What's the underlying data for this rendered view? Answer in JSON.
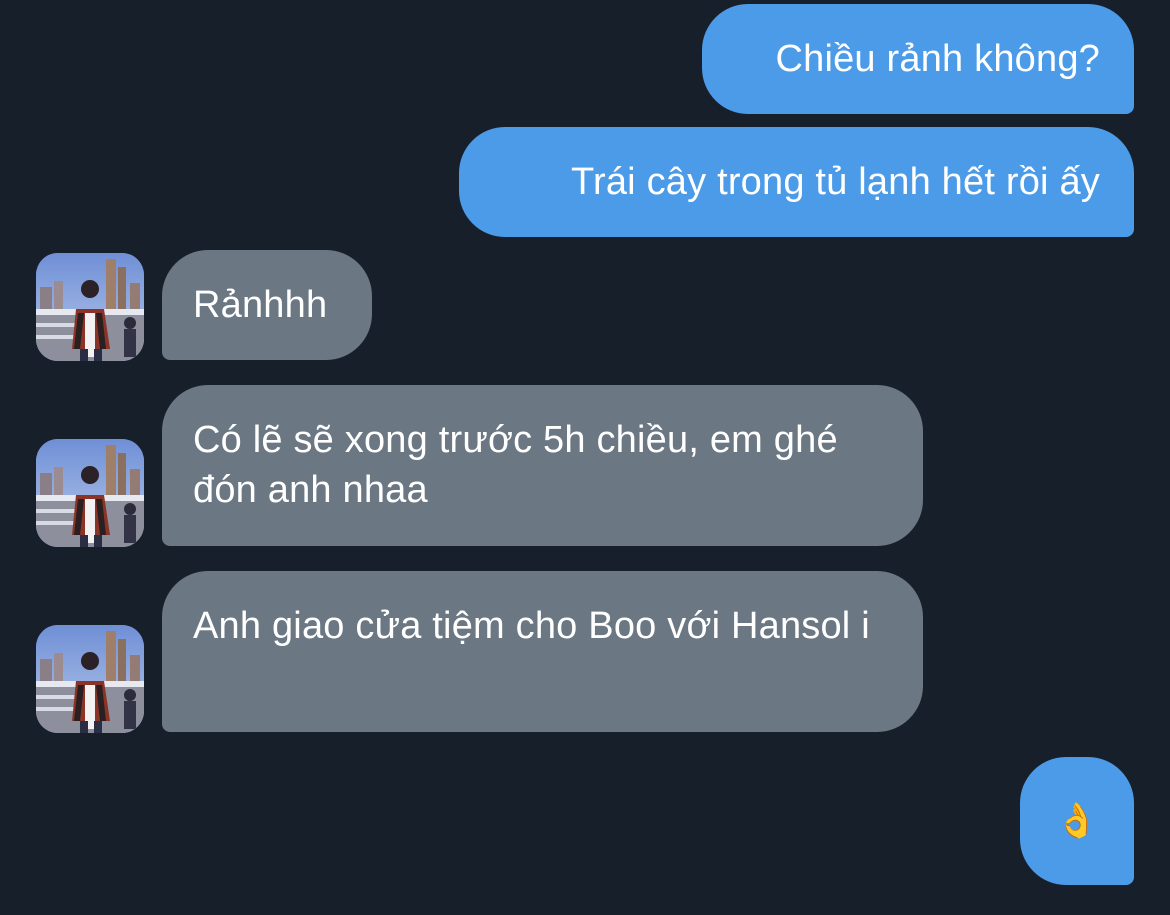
{
  "conversation": {
    "messages": [
      {
        "direction": "outgoing",
        "text": "Chiều rảnh không?"
      },
      {
        "direction": "outgoing",
        "text": "Trái cây trong tủ lạnh hết rồi ấy"
      },
      {
        "direction": "incoming",
        "text": "Rảnhhh"
      },
      {
        "direction": "incoming",
        "text": "Có lẽ sẽ xong trước 5h chiều, em ghé đón anh nhaa"
      },
      {
        "direction": "incoming",
        "text": "Anh giao cửa tiệm cho Boo với Hansol i"
      },
      {
        "direction": "outgoing",
        "text": "👌"
      }
    ]
  },
  "contact": {
    "avatar": "profile-photo-person-on-pier"
  },
  "colors": {
    "background": "#171f2a",
    "outgoing_bubble": "#4c9be8",
    "incoming_bubble": "#6b7783",
    "text": "#ffffff"
  }
}
